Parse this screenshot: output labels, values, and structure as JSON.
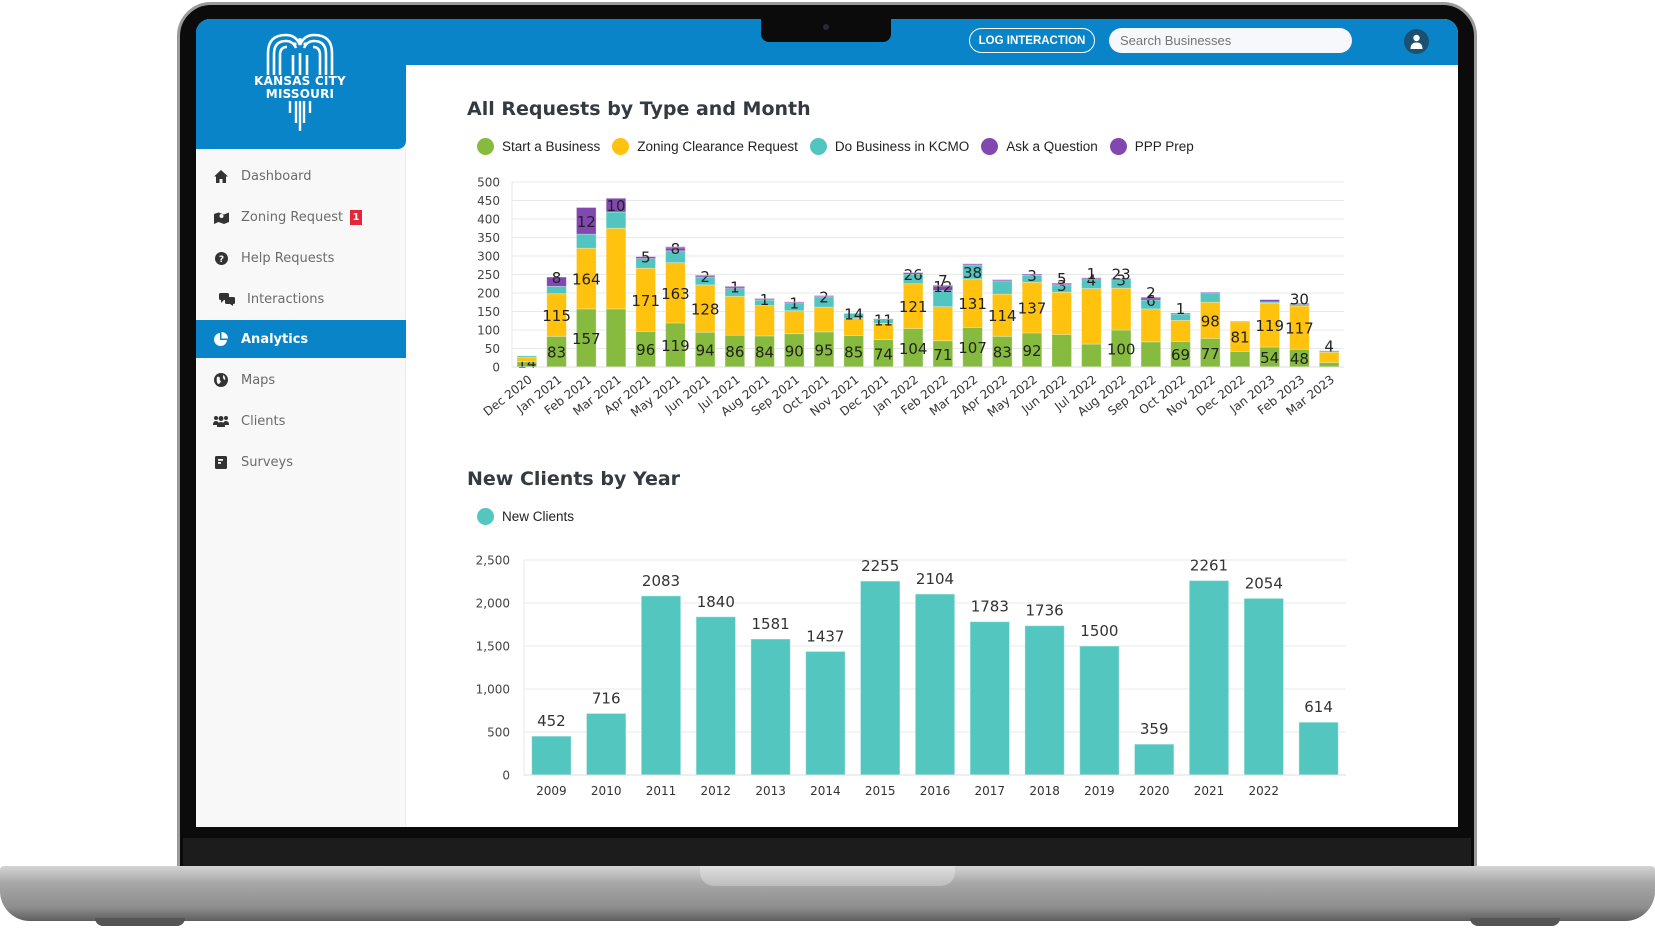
{
  "app": {
    "logo_line1": "KANSAS CITY",
    "logo_line2": "MISSOURI",
    "log_interaction_label": "LOG INTERACTION",
    "search_placeholder": "Search Businesses",
    "avatar_icon": "user-icon"
  },
  "sidebar": {
    "items": [
      {
        "label": "Dashboard",
        "icon": "home-icon",
        "active": false
      },
      {
        "label": "Zoning Request",
        "icon": "map-icon",
        "active": false,
        "badge": "1"
      },
      {
        "label": "Help Requests",
        "icon": "question-icon",
        "active": false
      },
      {
        "label": "Interactions",
        "icon": "chat-icon",
        "active": false
      },
      {
        "label": "Analytics",
        "icon": "pie-chart-icon",
        "active": true
      },
      {
        "label": "Maps",
        "icon": "globe-icon",
        "active": false
      },
      {
        "label": "Clients",
        "icon": "users-icon",
        "active": false
      },
      {
        "label": "Surveys",
        "icon": "survey-icon",
        "active": false
      }
    ]
  },
  "colors": {
    "brand_blue": "#0a84c9",
    "start_business": "#86bb3f",
    "zoning": "#ffc20e",
    "do_business": "#52c5c0",
    "ask_question": "#8148b0",
    "ppp_prep": "#8148b0",
    "new_clients": "#54c6c0"
  },
  "chart_data": [
    {
      "type": "bar",
      "stacked": true,
      "title": "All Requests by Type and Month",
      "legend_position": "top-left",
      "grid": true,
      "ylim": [
        0,
        500
      ],
      "yticks": [
        0,
        50,
        100,
        150,
        200,
        250,
        300,
        350,
        400,
        450,
        500
      ],
      "categories": [
        "Dec 2020",
        "Jan 2021",
        "Feb 2021",
        "Mar 2021",
        "Apr 2021",
        "May 2021",
        "Jun 2021",
        "Jul 2021",
        "Aug 2021",
        "Sep 2021",
        "Oct 2021",
        "Nov 2021",
        "Dec 2021",
        "Jan 2022",
        "Feb 2022",
        "Mar 2022",
        "Apr 2022",
        "May 2022",
        "Jun 2022",
        "Jul 2022",
        "Aug 2022",
        "Sep 2022",
        "Oct 2022",
        "Nov 2022",
        "Dec 2022",
        "Jan 2023",
        "Feb 2023",
        "Mar 2023"
      ],
      "series": [
        {
          "name": "Start a Business",
          "color": "#86bb3f",
          "values": [
            14,
            83,
            157,
            157,
            96,
            119,
            94,
            86,
            84,
            90,
            95,
            85,
            74,
            104,
            71,
            107,
            83,
            92,
            88,
            62,
            100,
            68,
            69,
            77,
            42,
            54,
            48,
            12
          ]
        },
        {
          "name": "Zoning Clearance Request",
          "color": "#ffc20e",
          "values": [
            12,
            115,
            164,
            218,
            171,
            163,
            128,
            105,
            82,
            62,
            67,
            46,
            44,
            121,
            92,
            131,
            114,
            137,
            114,
            150,
            113,
            89,
            57,
            98,
            81,
            119,
            117,
            28
          ]
        },
        {
          "name": "Do Business in KCMO",
          "color": "#52c5c0",
          "values": [
            4,
            20,
            38,
            44,
            26,
            32,
            20,
            21,
            15,
            22,
            28,
            14,
            11,
            26,
            44,
            38,
            36,
            19,
            20,
            24,
            23,
            24,
            18,
            26,
            1,
            3,
            4,
            4
          ]
        },
        {
          "name": "Ask a Question",
          "color": "#8148b0",
          "values": [
            0,
            25,
            72,
            37,
            5,
            8,
            4,
            5,
            3,
            1,
            1,
            0,
            1,
            4,
            12,
            3,
            3,
            3,
            3,
            4,
            3,
            6,
            1,
            1,
            0,
            6,
            3,
            0
          ]
        },
        {
          "name": "PPP Prep",
          "color": "#8148b0",
          "values": [
            0,
            0,
            0,
            0,
            0,
            3,
            2,
            1,
            1,
            1,
            2,
            0,
            0,
            0,
            2,
            0,
            0,
            0,
            2,
            1,
            0,
            2,
            1,
            0,
            0,
            0,
            0,
            0
          ]
        }
      ],
      "data_labels": {
        "Start a Business": [
          14,
          83,
          157,
          null,
          96,
          119,
          94,
          86,
          84,
          90,
          95,
          85,
          74,
          104,
          71,
          107,
          83,
          92,
          null,
          null,
          100,
          null,
          69,
          77,
          null,
          54,
          48,
          null
        ],
        "Zoning Clearance Request": [
          null,
          115,
          164,
          null,
          171,
          163,
          128,
          null,
          null,
          null,
          null,
          null,
          null,
          121,
          null,
          131,
          114,
          137,
          null,
          null,
          null,
          null,
          null,
          98,
          81,
          119,
          117,
          null
        ],
        "Do Business in KCMO": [
          null,
          null,
          null,
          null,
          null,
          null,
          null,
          null,
          null,
          null,
          null,
          14,
          11,
          26,
          null,
          38,
          null,
          3,
          3,
          4,
          3,
          6,
          null,
          null,
          null,
          null,
          null,
          null
        ],
        "Ask a Question": [
          null,
          8,
          12,
          10,
          5,
          8,
          2,
          1,
          1,
          1,
          2,
          null,
          null,
          null,
          12,
          null,
          null,
          null,
          null,
          null,
          null,
          null,
          null,
          null,
          null,
          null,
          null,
          null
        ],
        "top": [
          null,
          null,
          null,
          null,
          null,
          null,
          null,
          null,
          null,
          null,
          null,
          null,
          null,
          null,
          7,
          null,
          null,
          null,
          5,
          1,
          23,
          2,
          1,
          null,
          null,
          null,
          30,
          4
        ]
      }
    },
    {
      "type": "bar",
      "title": "New Clients by Year",
      "legend_position": "top-left",
      "grid": true,
      "series_name": "New Clients",
      "color": "#54c6c0",
      "ylim": [
        0,
        2500
      ],
      "yticks": [
        "0",
        "500",
        "1,000",
        "1,500",
        "2,000",
        "2,500"
      ],
      "categories": [
        "2009",
        "2010",
        "2011",
        "2012",
        "2013",
        "2014",
        "2015",
        "2016",
        "2017",
        "2018",
        "2019",
        "2020",
        "2021",
        "2022",
        ""
      ],
      "values": [
        452,
        716,
        2083,
        1840,
        1581,
        1437,
        2255,
        2104,
        1783,
        1736,
        1500,
        359,
        2261,
        2054,
        614
      ]
    }
  ]
}
